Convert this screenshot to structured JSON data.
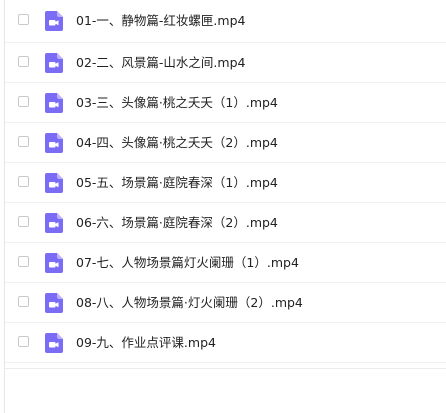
{
  "files": [
    {
      "name": "01-一、静物篇-红妆螺匣.mp4",
      "icon": "video-file-icon"
    },
    {
      "name": "02-二、风景篇-山水之间.mp4",
      "icon": "video-file-icon"
    },
    {
      "name": "03-三、头像篇·桃之夭夭（1）.mp4",
      "icon": "video-file-icon"
    },
    {
      "name": "04-四、头像篇·桃之夭夭（2）.mp4",
      "icon": "video-file-icon"
    },
    {
      "name": "05-五、场景篇·庭院春深（1）.mp4",
      "icon": "video-file-icon"
    },
    {
      "name": "06-六、场景篇·庭院春深（2）.mp4",
      "icon": "video-file-icon"
    },
    {
      "name": "07-七、人物场景篇灯火阑珊（1）.mp4",
      "icon": "video-file-icon"
    },
    {
      "name": "08-八、人物场景篇·灯火阑珊（2）.mp4",
      "icon": "video-file-icon"
    },
    {
      "name": "09-九、作业点评课.mp4",
      "icon": "video-file-icon"
    }
  ],
  "colors": {
    "icon_fill": "#7b6cf6",
    "icon_fold": "#b9b1fb",
    "icon_glyph": "#ffffff",
    "text": "#222222",
    "checkbox_border": "#c9c9c9"
  }
}
